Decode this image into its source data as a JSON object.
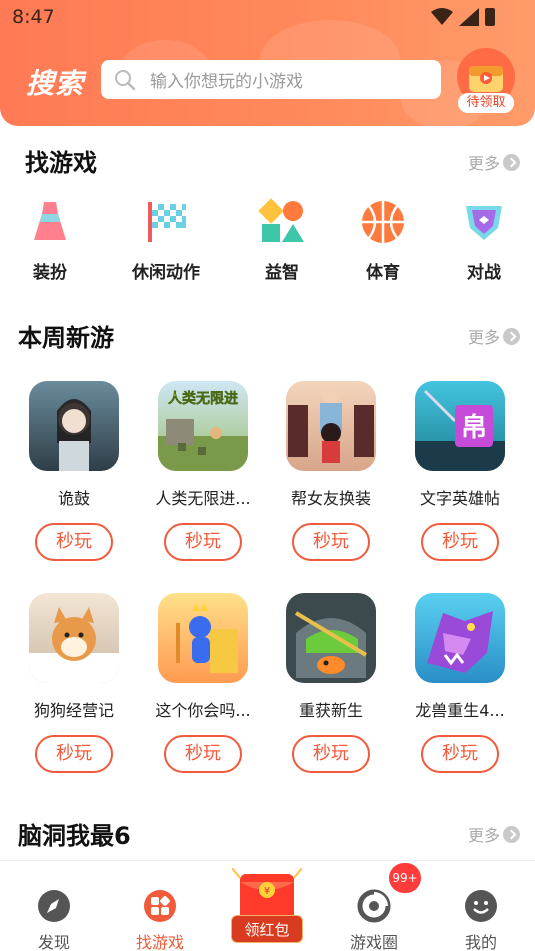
{
  "status_bar": {
    "time": "8:47"
  },
  "header": {
    "title": "搜索",
    "search_placeholder": "输入你想玩的小游戏",
    "reward_badge": "待领取"
  },
  "find_games": {
    "title": "找游戏",
    "more": "更多",
    "categories": [
      {
        "label": "装扮",
        "icon": "dress-icon"
      },
      {
        "label": "休闲动作",
        "icon": "checkered-flag-icon"
      },
      {
        "label": "益智",
        "icon": "shapes-icon"
      },
      {
        "label": "体育",
        "icon": "basketball-icon"
      },
      {
        "label": "对战",
        "icon": "shield-icon"
      }
    ]
  },
  "new_this_week": {
    "title": "本周新游",
    "more": "更多",
    "play_label": "秒玩",
    "games": [
      {
        "name": "诡鼓"
      },
      {
        "name": "人类无限进..."
      },
      {
        "name": "帮女友换装"
      },
      {
        "name": "文字英雄帖"
      },
      {
        "name": "狗狗经营记"
      },
      {
        "name": "这个你会吗..."
      },
      {
        "name": "重获新生"
      },
      {
        "name": "龙兽重生4..."
      }
    ],
    "game_icon_text": {
      "humans": "人类无限进",
      "hero": "帛"
    }
  },
  "brain_hole": {
    "title": "脑洞我最6",
    "more": "更多"
  },
  "bottom_nav": {
    "items": [
      {
        "label": "发现",
        "icon": "compass-icon"
      },
      {
        "label": "找游戏",
        "icon": "games-grid-icon"
      },
      {
        "label": "领红包",
        "icon": "red-packet-icon"
      },
      {
        "label": "游戏圈",
        "icon": "circle-icon"
      },
      {
        "label": "我的",
        "icon": "profile-icon"
      }
    ],
    "badge": "99+",
    "active_index": 1
  },
  "colors": {
    "accent": "#f15a3a",
    "header": "#ff7a55"
  }
}
